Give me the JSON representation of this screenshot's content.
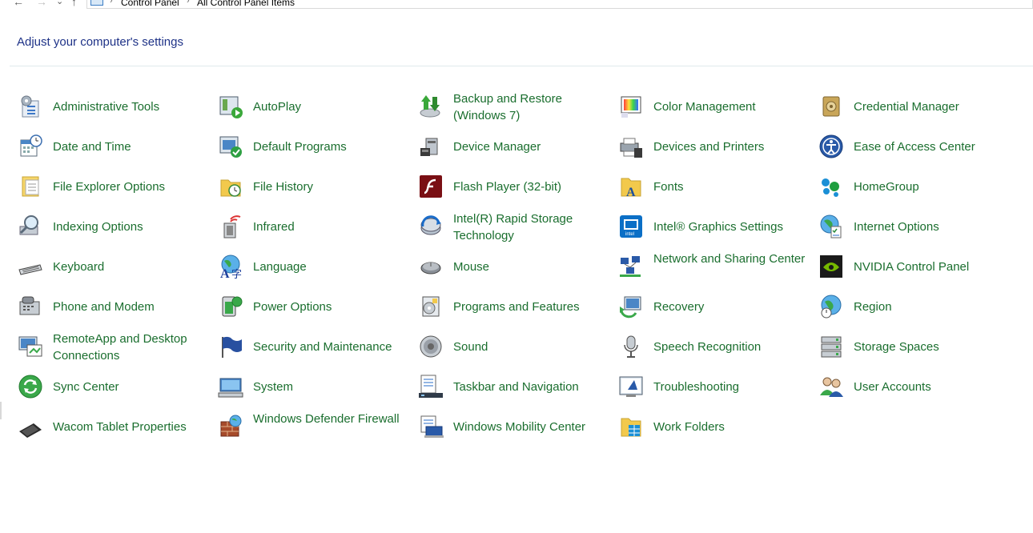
{
  "nav": {
    "back": "←",
    "forward": "→",
    "recent": "⌄",
    "up": "↑"
  },
  "breadcrumb": {
    "items": [
      "Control Panel",
      "All Control Panel Items"
    ],
    "separator": "›"
  },
  "heading": "Adjust your computer's settings",
  "colors": {
    "link": "#1a6e2e",
    "heading": "#1e3287"
  },
  "items": [
    {
      "label": "Administrative Tools",
      "icon": "administrative-tools-icon"
    },
    {
      "label": "AutoPlay",
      "icon": "autoplay-icon"
    },
    {
      "label": "Backup and Restore (Windows 7)",
      "icon": "backup-restore-icon"
    },
    {
      "label": "Color Management",
      "icon": "color-management-icon"
    },
    {
      "label": "Credential Manager",
      "icon": "credential-manager-icon"
    },
    {
      "label": "Date and Time",
      "icon": "date-time-icon"
    },
    {
      "label": "Default Programs",
      "icon": "default-programs-icon"
    },
    {
      "label": "Device Manager",
      "icon": "device-manager-icon"
    },
    {
      "label": "Devices and Printers",
      "icon": "devices-printers-icon"
    },
    {
      "label": "Ease of Access Center",
      "icon": "ease-of-access-icon"
    },
    {
      "label": "File Explorer Options",
      "icon": "file-explorer-options-icon"
    },
    {
      "label": "File History",
      "icon": "file-history-icon"
    },
    {
      "label": "Flash Player (32-bit)",
      "icon": "flash-player-icon"
    },
    {
      "label": "Fonts",
      "icon": "fonts-icon"
    },
    {
      "label": "HomeGroup",
      "icon": "homegroup-icon"
    },
    {
      "label": "Indexing Options",
      "icon": "indexing-options-icon"
    },
    {
      "label": "Infrared",
      "icon": "infrared-icon"
    },
    {
      "label": "Intel(R) Rapid Storage Technology",
      "icon": "intel-rapid-storage-icon"
    },
    {
      "label": "Intel® Graphics Settings",
      "icon": "intel-graphics-icon"
    },
    {
      "label": "Internet Options",
      "icon": "internet-options-icon"
    },
    {
      "label": "Keyboard",
      "icon": "keyboard-icon"
    },
    {
      "label": "Language",
      "icon": "language-icon"
    },
    {
      "label": "Mouse",
      "icon": "mouse-icon"
    },
    {
      "label": "Network and Sharing Center",
      "icon": "network-sharing-icon"
    },
    {
      "label": "NVIDIA Control Panel",
      "icon": "nvidia-icon"
    },
    {
      "label": "Phone and Modem",
      "icon": "phone-modem-icon"
    },
    {
      "label": "Power Options",
      "icon": "power-options-icon"
    },
    {
      "label": "Programs and Features",
      "icon": "programs-features-icon"
    },
    {
      "label": "Recovery",
      "icon": "recovery-icon"
    },
    {
      "label": "Region",
      "icon": "region-icon"
    },
    {
      "label": "RemoteApp and Desktop Connections",
      "icon": "remoteapp-icon"
    },
    {
      "label": "Security and Maintenance",
      "icon": "security-maintenance-icon"
    },
    {
      "label": "Sound",
      "icon": "sound-icon"
    },
    {
      "label": "Speech Recognition",
      "icon": "speech-recognition-icon"
    },
    {
      "label": "Storage Spaces",
      "icon": "storage-spaces-icon"
    },
    {
      "label": "Sync Center",
      "icon": "sync-center-icon"
    },
    {
      "label": "System",
      "icon": "system-icon"
    },
    {
      "label": "Taskbar and Navigation",
      "icon": "taskbar-navigation-icon"
    },
    {
      "label": "Troubleshooting",
      "icon": "troubleshooting-icon"
    },
    {
      "label": "User Accounts",
      "icon": "user-accounts-icon"
    },
    {
      "label": "Wacom Tablet Properties",
      "icon": "wacom-tablet-icon"
    },
    {
      "label": "Windows Defender Firewall",
      "icon": "windows-firewall-icon"
    },
    {
      "label": "Windows Mobility Center",
      "icon": "mobility-center-icon"
    },
    {
      "label": "Work Folders",
      "icon": "work-folders-icon"
    }
  ]
}
